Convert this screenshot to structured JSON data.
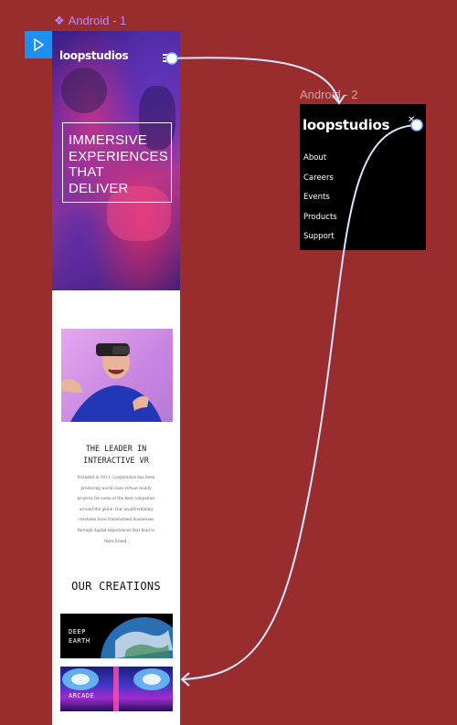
{
  "canvas": {
    "frame1_title": "Android - 1",
    "frame2_title": "Android - 2",
    "component_icon": "component-icon",
    "play_icon": "play-icon",
    "colors": {
      "background": "#992c2d",
      "frame_title": "#b58cff",
      "connector": "#d6e6ff",
      "play_button": "#1f8ef1"
    }
  },
  "mobile_home": {
    "logo": "loopstudios",
    "menu_icon": "hamburger-icon",
    "hero_lines": [
      "IMMERSIVE",
      "EXPERIENCES",
      "THAT",
      "DELIVER"
    ],
    "about": {
      "heading_lines": [
        "THE LEADER IN",
        "INTERACTIVE VR"
      ],
      "body_lines": [
        "Founded in 2011, Loopstudios has been",
        "producing world-class virtual reality",
        "projects for some of the best companies",
        "around the globe. Our award-winning",
        "creations have transformed businesses",
        "through digital experiences that bind to",
        "their brand."
      ]
    },
    "creations": {
      "heading": "OUR CREATIONS",
      "cards": [
        {
          "label_lines": [
            "DEEP",
            "EARTH"
          ]
        },
        {
          "label_lines": [
            "ARCADE"
          ]
        }
      ]
    }
  },
  "mobile_menu": {
    "logo": "loopstudios",
    "close_icon": "close-icon",
    "items": [
      "About",
      "Careers",
      "Events",
      "Products",
      "Support"
    ]
  }
}
